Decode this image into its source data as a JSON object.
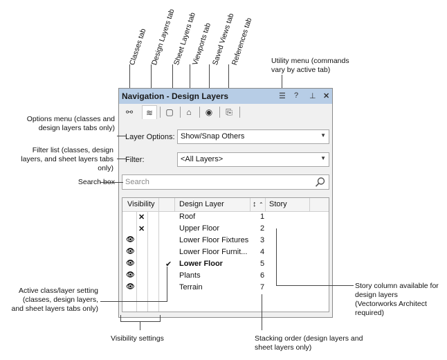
{
  "rotated_labels": {
    "classes_tab": "Classes tab",
    "design_layers_tab": "Design Layers tab",
    "sheet_layers_tab": "Sheet Layers tab",
    "viewports_tab": "Viewports tab",
    "saved_views_tab": "Saved Views tab",
    "references_tab": "References tab"
  },
  "callouts": {
    "utility_menu": "Utility menu (commands vary by active tab)",
    "options_menu": "Options menu (classes and design layers tabs only)",
    "filter_list": "Filter list (classes, design layers, and sheet layers tabs only)",
    "search_box": "Search box",
    "active_setting": "Active class/layer setting (classes, design layers, and sheet layers tabs only)",
    "visibility_settings": "Visibility settings",
    "stacking_order": "Stacking order (design layers and sheet layers only)",
    "story_column": "Story column available for design layers (Vectorworks Architect required)"
  },
  "palette": {
    "title": "Navigation - Design Layers",
    "titlebar_icons": [
      "menu-icon",
      "help-icon",
      "pin-icon",
      "close-icon"
    ],
    "tabs": [
      {
        "name": "classes",
        "icon": "classes-icon",
        "glyph": "⚯"
      },
      {
        "name": "design-layers",
        "icon": "design-layers-icon",
        "glyph": "≋"
      },
      {
        "name": "sheet-layers",
        "icon": "sheet-layers-icon",
        "glyph": "▢"
      },
      {
        "name": "viewports",
        "icon": "viewports-icon",
        "glyph": "⌂"
      },
      {
        "name": "saved-views",
        "icon": "saved-views-icon",
        "glyph": "◉"
      },
      {
        "name": "references",
        "icon": "references-icon",
        "glyph": "⎘"
      }
    ],
    "active_tab": "design-layers",
    "layer_options_label": "Layer Options:",
    "layer_options_value": "Show/Snap Others",
    "filter_label": "Filter:",
    "filter_value": "<All Layers>",
    "search_placeholder": "Search",
    "columns": {
      "visibility": "Visibility",
      "design_layer": "Design Layer",
      "order": "↕",
      "story": "Story"
    },
    "rows": [
      {
        "vis": "✕",
        "vis_col": 1,
        "active": "",
        "name": "Roof",
        "order": "1",
        "bold": false
      },
      {
        "vis": "✕",
        "vis_col": 1,
        "active": "",
        "name": "Upper Floor",
        "order": "2",
        "bold": false
      },
      {
        "vis": "👁",
        "vis_col": 0,
        "active": "",
        "name": "Lower Floor Fixtures",
        "order": "3",
        "bold": false
      },
      {
        "vis": "👁",
        "vis_col": 0,
        "active": "",
        "name": "Lower Floor Furnit...",
        "order": "4",
        "bold": false
      },
      {
        "vis": "👁",
        "vis_col": 0,
        "active": "✔",
        "name": "Lower Floor",
        "order": "5",
        "bold": true
      },
      {
        "vis": "👁",
        "vis_col": 0,
        "active": "",
        "name": "Plants",
        "order": "6",
        "bold": false
      },
      {
        "vis": "👁",
        "vis_col": 0,
        "active": "",
        "name": "Terrain",
        "order": "7",
        "bold": false
      }
    ]
  },
  "colors": {
    "titlebar": "#b7cde6",
    "panel": "#f0f0f0",
    "lead_lines": "#444444"
  }
}
